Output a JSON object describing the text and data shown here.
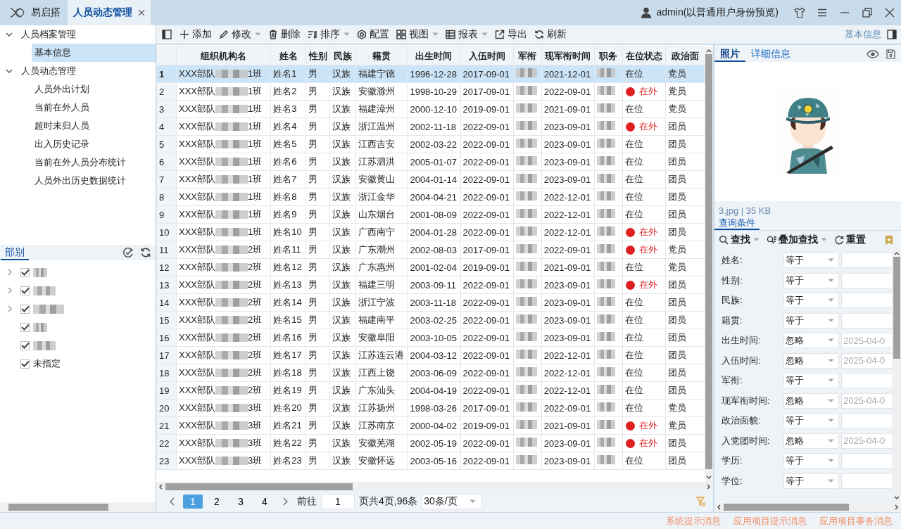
{
  "app_tab": {
    "label": "易启搭"
  },
  "open_tabs": [
    {
      "label": "人员动态管理",
      "selected": true
    }
  ],
  "user": {
    "label": "admin(以普通用户身份预览)"
  },
  "nav_tree": [
    {
      "label": "人员档案管理",
      "expanded": true,
      "selected": false,
      "children": [
        {
          "label": "基本信息",
          "selected": true
        }
      ]
    },
    {
      "label": "人员动态管理",
      "expanded": true,
      "selected": false,
      "children": [
        {
          "label": "人员外出计划",
          "selected": false
        },
        {
          "label": "当前在外人员",
          "selected": false
        },
        {
          "label": "超时未归人员",
          "selected": false
        },
        {
          "label": "出入历史记录",
          "selected": false
        },
        {
          "label": "当前在外人员分布统计",
          "selected": false
        },
        {
          "label": "人员外出历史数据统计",
          "selected": false
        }
      ]
    }
  ],
  "dept_panel": {
    "tab": "部别",
    "items": [
      {
        "kind": "branch",
        "checked": true,
        "redacted": true
      },
      {
        "kind": "branch",
        "checked": true,
        "redacted": true
      },
      {
        "kind": "branch",
        "checked": true,
        "redacted": true
      },
      {
        "kind": "leaf",
        "checked": true,
        "redacted": true
      },
      {
        "kind": "leaf",
        "checked": true,
        "redacted": true
      },
      {
        "kind": "leaf",
        "checked": true,
        "redacted": false,
        "label": "未指定"
      }
    ]
  },
  "toolbar": [
    {
      "kind": "add",
      "label": "添加",
      "dropdown": false
    },
    {
      "kind": "edit",
      "label": "修改",
      "dropdown": true
    },
    {
      "kind": "delete",
      "label": "删除",
      "dropdown": false
    },
    {
      "kind": "sort",
      "label": "排序",
      "dropdown": true
    },
    {
      "kind": "config",
      "label": "配置",
      "dropdown": false
    },
    {
      "kind": "view",
      "label": "视图",
      "dropdown": true
    },
    {
      "kind": "report",
      "label": "报表",
      "dropdown": true
    },
    {
      "kind": "export",
      "label": "导出",
      "dropdown": false
    },
    {
      "kind": "refresh",
      "label": "刷新",
      "dropdown": false
    }
  ],
  "detail_toggle": {
    "label": "基本信息"
  },
  "table": {
    "columns": [
      "组织机构名",
      "姓名",
      "性别",
      "民族",
      "籍贯",
      "出生时间",
      "入伍时间",
      "军衔",
      "现军衔时间",
      "职务",
      "在位状态",
      "政治面"
    ],
    "rows": [
      {
        "n": "1",
        "org": "XXX部队",
        "unit": "1班",
        "name": "姓名1",
        "sex": "男",
        "ethnic": "汉族",
        "native": "福建宁德",
        "birth": "1996-12-28",
        "enlist": "2017-09-01",
        "rank_date": "2021-12-01",
        "status": "在位",
        "away": false,
        "party": "党员",
        "selected": true
      },
      {
        "n": "2",
        "org": "XXX部队",
        "unit": "1班",
        "name": "姓名2",
        "sex": "男",
        "ethnic": "汉族",
        "native": "安徽滁州",
        "birth": "1998-10-29",
        "enlist": "2017-09-01",
        "rank_date": "2022-09-01",
        "status": "在外",
        "away": true,
        "party": "党员",
        "selected": false
      },
      {
        "n": "3",
        "org": "XXX部队",
        "unit": "1班",
        "name": "姓名3",
        "sex": "男",
        "ethnic": "汉族",
        "native": "福建漳州",
        "birth": "2000-12-10",
        "enlist": "2019-09-01",
        "rank_date": "2021-09-01",
        "status": "在位",
        "away": false,
        "party": "党员",
        "selected": false
      },
      {
        "n": "4",
        "org": "XXX部队",
        "unit": "1班",
        "name": "姓名4",
        "sex": "男",
        "ethnic": "汉族",
        "native": "浙江温州",
        "birth": "2002-11-18",
        "enlist": "2022-09-01",
        "rank_date": "2023-09-01",
        "status": "在外",
        "away": true,
        "party": "团员",
        "selected": false
      },
      {
        "n": "5",
        "org": "XXX部队",
        "unit": "1班",
        "name": "姓名5",
        "sex": "男",
        "ethnic": "汉族",
        "native": "江西吉安",
        "birth": "2002-03-22",
        "enlist": "2022-09-01",
        "rank_date": "2023-09-01",
        "status": "在位",
        "away": false,
        "party": "团员",
        "selected": false
      },
      {
        "n": "6",
        "org": "XXX部队",
        "unit": "1班",
        "name": "姓名6",
        "sex": "男",
        "ethnic": "汉族",
        "native": "江苏泗洪",
        "birth": "2005-01-07",
        "enlist": "2022-09-01",
        "rank_date": "2023-09-01",
        "status": "在位",
        "away": false,
        "party": "团员",
        "selected": false
      },
      {
        "n": "7",
        "org": "XXX部队",
        "unit": "1班",
        "name": "姓名7",
        "sex": "男",
        "ethnic": "汉族",
        "native": "安徽黄山",
        "birth": "2004-01-14",
        "enlist": "2022-09-01",
        "rank_date": "2023-09-01",
        "status": "在位",
        "away": false,
        "party": "团员",
        "selected": false
      },
      {
        "n": "8",
        "org": "XXX部队",
        "unit": "1班",
        "name": "姓名8",
        "sex": "男",
        "ethnic": "汉族",
        "native": "浙江金华",
        "birth": "2004-04-21",
        "enlist": "2022-09-01",
        "rank_date": "2022-12-01",
        "status": "在位",
        "away": false,
        "party": "团员",
        "selected": false
      },
      {
        "n": "9",
        "org": "XXX部队",
        "unit": "1班",
        "name": "姓名9",
        "sex": "男",
        "ethnic": "汉族",
        "native": "山东烟台",
        "birth": "2001-08-09",
        "enlist": "2022-09-01",
        "rank_date": "2022-12-01",
        "status": "在位",
        "away": false,
        "party": "团员",
        "selected": false
      },
      {
        "n": "10",
        "org": "XXX部队",
        "unit": "1班",
        "name": "姓名10",
        "sex": "男",
        "ethnic": "汉族",
        "native": "广西南宁",
        "birth": "2004-01-28",
        "enlist": "2022-09-01",
        "rank_date": "2022-12-01",
        "status": "在外",
        "away": true,
        "party": "团员",
        "selected": false
      },
      {
        "n": "11",
        "org": "XXX部队",
        "unit": "2班",
        "name": "姓名11",
        "sex": "男",
        "ethnic": "汉族",
        "native": "广东潮州",
        "birth": "2002-08-03",
        "enlist": "2017-09-01",
        "rank_date": "2022-09-01",
        "status": "在外",
        "away": true,
        "party": "党员",
        "selected": false
      },
      {
        "n": "12",
        "org": "XXX部队",
        "unit": "2班",
        "name": "姓名12",
        "sex": "男",
        "ethnic": "汉族",
        "native": "广东惠州",
        "birth": "2001-02-04",
        "enlist": "2019-09-01",
        "rank_date": "2021-09-01",
        "status": "在位",
        "away": false,
        "party": "党员",
        "selected": false
      },
      {
        "n": "13",
        "org": "XXX部队",
        "unit": "2班",
        "name": "姓名13",
        "sex": "男",
        "ethnic": "汉族",
        "native": "福建三明",
        "birth": "2003-09-11",
        "enlist": "2022-09-01",
        "rank_date": "2023-09-01",
        "status": "在外",
        "away": true,
        "party": "团员",
        "selected": false
      },
      {
        "n": "14",
        "org": "XXX部队",
        "unit": "2班",
        "name": "姓名14",
        "sex": "男",
        "ethnic": "汉族",
        "native": "浙江宁波",
        "birth": "2003-11-18",
        "enlist": "2022-09-01",
        "rank_date": "2023-09-01",
        "status": "在位",
        "away": false,
        "party": "团员",
        "selected": false
      },
      {
        "n": "15",
        "org": "XXX部队",
        "unit": "2班",
        "name": "姓名15",
        "sex": "男",
        "ethnic": "汉族",
        "native": "福建南平",
        "birth": "2003-02-25",
        "enlist": "2022-09-01",
        "rank_date": "2023-09-01",
        "status": "在位",
        "away": false,
        "party": "团员",
        "selected": false
      },
      {
        "n": "16",
        "org": "XXX部队",
        "unit": "2班",
        "name": "姓名16",
        "sex": "男",
        "ethnic": "汉族",
        "native": "安徽阜阳",
        "birth": "2003-10-05",
        "enlist": "2022-09-01",
        "rank_date": "2023-09-01",
        "status": "在位",
        "away": false,
        "party": "团员",
        "selected": false
      },
      {
        "n": "17",
        "org": "XXX部队",
        "unit": "2班",
        "name": "姓名17",
        "sex": "男",
        "ethnic": "汉族",
        "native": "江苏连云港",
        "birth": "2004-03-12",
        "enlist": "2022-09-01",
        "rank_date": "2022-12-01",
        "status": "在位",
        "away": false,
        "party": "团员",
        "selected": false
      },
      {
        "n": "18",
        "org": "XXX部队",
        "unit": "2班",
        "name": "姓名18",
        "sex": "男",
        "ethnic": "汉族",
        "native": "江西上饶",
        "birth": "2003-06-09",
        "enlist": "2022-09-01",
        "rank_date": "2022-12-01",
        "status": "在位",
        "away": false,
        "party": "团员",
        "selected": false
      },
      {
        "n": "19",
        "org": "XXX部队",
        "unit": "2班",
        "name": "姓名19",
        "sex": "男",
        "ethnic": "汉族",
        "native": "广东汕头",
        "birth": "2004-04-19",
        "enlist": "2022-09-01",
        "rank_date": "2022-12-01",
        "status": "在位",
        "away": false,
        "party": "团员",
        "selected": false
      },
      {
        "n": "20",
        "org": "XXX部队",
        "unit": "3班",
        "name": "姓名20",
        "sex": "男",
        "ethnic": "汉族",
        "native": "江苏扬州",
        "birth": "1998-03-26",
        "enlist": "2017-09-01",
        "rank_date": "2022-09-01",
        "status": "在位",
        "away": false,
        "party": "党员",
        "selected": false
      },
      {
        "n": "21",
        "org": "XXX部队",
        "unit": "3班",
        "name": "姓名21",
        "sex": "男",
        "ethnic": "汉族",
        "native": "江苏南京",
        "birth": "2000-04-02",
        "enlist": "2019-09-01",
        "rank_date": "2021-09-01",
        "status": "在外",
        "away": true,
        "party": "党员",
        "selected": false
      },
      {
        "n": "22",
        "org": "XXX部队",
        "unit": "3班",
        "name": "姓名22",
        "sex": "男",
        "ethnic": "汉族",
        "native": "安徽芜湖",
        "birth": "2002-05-19",
        "enlist": "2022-09-01",
        "rank_date": "2023-09-01",
        "status": "在外",
        "away": true,
        "party": "团员",
        "selected": false
      },
      {
        "n": "23",
        "org": "XXX部队",
        "unit": "3班",
        "name": "姓名23",
        "sex": "男",
        "ethnic": "汉族",
        "native": "安徽怀远",
        "birth": "2003-05-16",
        "enlist": "2022-09-01",
        "rank_date": "2023-09-01",
        "status": "在位",
        "away": false,
        "party": "团员",
        "selected": false
      }
    ]
  },
  "pager": {
    "pages": [
      {
        "label": "1",
        "selected": true
      },
      {
        "label": "2",
        "selected": false
      },
      {
        "label": "3",
        "selected": false
      },
      {
        "label": "4",
        "selected": false
      }
    ],
    "goto_label": "前往",
    "goto_value": "1",
    "summary": "页共4页,96条",
    "page_size": "30条/页"
  },
  "detail_tabs": [
    {
      "label": "照片",
      "selected": true
    },
    {
      "label": "详细信息",
      "selected": false
    }
  ],
  "photo": {
    "kind": "picture",
    "file_info": "3.jpg | 35 KB"
  },
  "query": {
    "tab": "查询条件",
    "actions": [
      {
        "kind": "search",
        "label": "查找",
        "dropdown": true
      },
      {
        "kind": "add_search",
        "label": "叠加查找",
        "dropdown": true
      },
      {
        "kind": "reset",
        "label": "重置",
        "dropdown": false
      }
    ],
    "fields": [
      {
        "label": "姓名:",
        "op": "等于"
      },
      {
        "label": "性别:",
        "op": "等于"
      },
      {
        "label": "民族:",
        "op": "等于"
      },
      {
        "label": "籍贯:",
        "op": "等于"
      },
      {
        "label": "出生时间:",
        "op": "忽略",
        "placeholder": "2025-04-0"
      },
      {
        "label": "入伍时间:",
        "op": "忽略",
        "placeholder": "2025-04-0"
      },
      {
        "label": "军衔:",
        "op": "等于"
      },
      {
        "label": "现军衔时间:",
        "op": "忽略",
        "placeholder": "2025-04-0"
      },
      {
        "label": "政治面貌:",
        "op": "等于"
      },
      {
        "label": "入党团时间:",
        "op": "忽略",
        "placeholder": "2025-04-0"
      },
      {
        "label": "学历:",
        "op": "等于"
      },
      {
        "label": "学位:",
        "op": "等于"
      }
    ]
  },
  "status_bar": [
    "系统提示消息",
    "应用项目提示消息",
    "应用项目事务消息"
  ]
}
